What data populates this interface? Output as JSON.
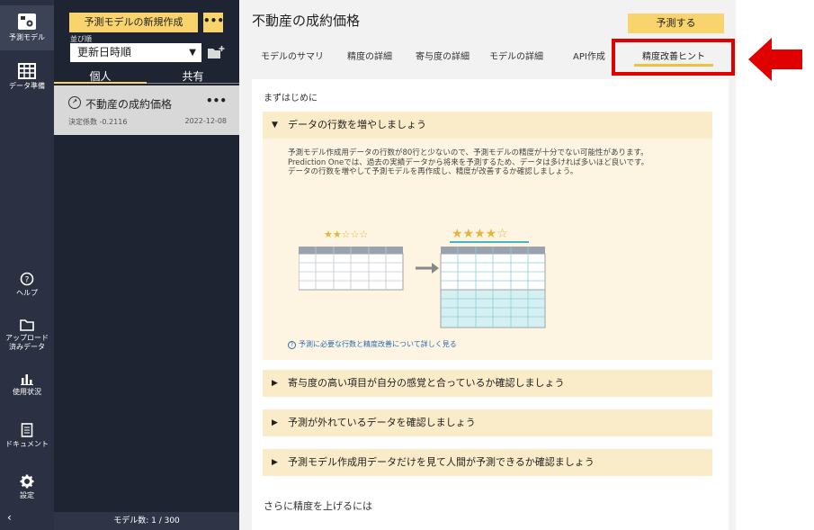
{
  "rail": {
    "items": [
      {
        "label": "予測モデル",
        "icon": "model-icon"
      },
      {
        "label": "データ準備",
        "icon": "table-icon"
      },
      {
        "label": "ヘルプ",
        "icon": "help-icon"
      },
      {
        "label1": "アップロード",
        "label2": "済みデータ",
        "icon": "folder-icon"
      },
      {
        "label": "使用状況",
        "icon": "bar-chart-icon"
      },
      {
        "label": "ドキュメント",
        "icon": "document-icon"
      },
      {
        "label": "設定",
        "icon": "gear-icon"
      }
    ],
    "collapse": "‹"
  },
  "panel": {
    "new_model_label": "予測モデルの新規作成",
    "more_label": "•••",
    "sort_caption": "並び順",
    "sort_value": "更新日時順",
    "tabs": {
      "personal": "個人",
      "shared": "共有"
    },
    "model": {
      "name": "不動産の成約価格",
      "coef": "決定係数 -0.2116",
      "date": "2022-12-08",
      "more": "•••"
    },
    "count": "モデル数: 1 / 300"
  },
  "main": {
    "title": "不動産の成約価格",
    "predict_label": "予測する",
    "tabs": [
      "モデルのサマリ",
      "精度の詳細",
      "寄与度の詳細",
      "モデルの詳細",
      "API作成",
      "精度改善ヒント"
    ],
    "intro": "まずはじめに",
    "open_section": {
      "title": "データの行数を増やしましょう",
      "line1": "予測モデル作成用データの行数が80行と少ないので、予測モデルの精度が十分でない可能性があります。",
      "line2": "Prediction Oneでは、過去の実績データから将来を予測するため、データは多ければ多いほど良いです。",
      "line3": "データの行数を増やして予測モデルを再作成し、精度が改善するか確認しましょう。",
      "link": "予測に必要な行数と精度改善について詳しく見る",
      "stars_before": "★★☆☆☆",
      "stars_after": "★★★★☆"
    },
    "sections": [
      "寄与度の高い項目が自分の感覚と合っているか確認しましょう",
      "予測が外れているデータを確認しましょう",
      "予測モデル作成用データだけを見て人間が予測できるか確認ましょう"
    ],
    "more_title": "さらに精度を上げるには"
  },
  "colors": {
    "accent": "#f9d36c",
    "highlight": "#e00000",
    "rail": "#2b3142"
  }
}
